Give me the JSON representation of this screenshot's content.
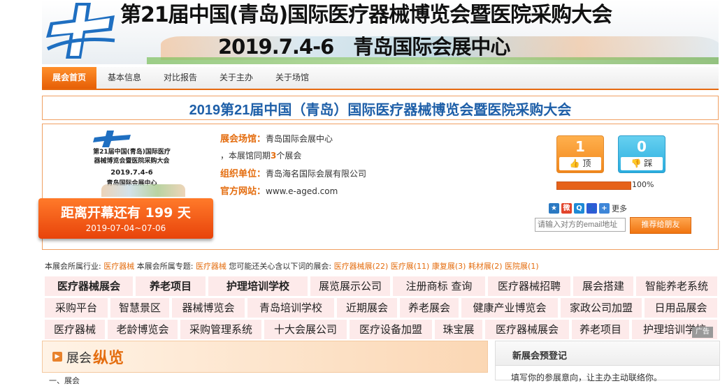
{
  "banner": {
    "title": "第21届中国(青岛)国际医疗器械博览会暨医院采购大会",
    "date": "2019.7.4-6　青岛国际会展中心"
  },
  "nav": {
    "items": [
      "展会首页",
      "基本信息",
      "对比报告",
      "关于主办",
      "关于场馆"
    ]
  },
  "page_title": "2019第21届中国（青岛）国际医疗器械博览会暨医院采购大会",
  "thumbnail": {
    "line1": "第21届中国(青岛)国际医疗",
    "line2": "器械博览会暨医院采购大会",
    "line3": "2019.7.4-6",
    "line4": "青岛国际会展中心"
  },
  "countdown": {
    "main": "距离开幕还有 199 天",
    "dates": "2019-07-04~07-06"
  },
  "info": {
    "venue_label": "展会场馆：",
    "venue": "青岛国际会展中心",
    "same_period_prefix": "，本展馆同期",
    "same_period_count": "3",
    "same_period_suffix": "个展会",
    "organizer_label": "组织单位：",
    "organizer": "青岛海名国际会展有限公司",
    "website_label": "官方网站：",
    "website": "www.e-aged.com"
  },
  "votes": {
    "up_count": "1",
    "up_label": "顶",
    "down_count": "0",
    "down_label": "踩",
    "progress_percent": 100,
    "progress_text": "100%"
  },
  "share": {
    "more_label": "更多",
    "email_placeholder": "请输入对方的email地址",
    "recommend_label": "推荐给朋友"
  },
  "colors": {
    "accent": "#e46d0f",
    "title_blue": "#1e5fa8",
    "ad_bg": "#fdeaea"
  },
  "industry": {
    "t1": "本展会所属行业:",
    "l1": "医疗器械",
    "t2": "本展会所属专题:",
    "l2": "医疗器械",
    "t3": "您可能还关心含以下词的展会:",
    "links": [
      "医疗器械展(22)",
      "医疗展(11)",
      "康复展(3)",
      "耗材展(2)",
      "医院展(1)"
    ]
  },
  "ads": {
    "row1": [
      "医疗器械展会",
      "养老项目",
      "护理培训学校",
      "展览展示公司",
      "注册商标 查询",
      "医疗器械招聘",
      "展会搭建",
      "智能养老系统"
    ],
    "row2": [
      "采购平台",
      "智慧景区",
      "器械博览会",
      "青岛培训学校",
      "近期展会",
      "养老展会",
      "健康产业博览会",
      "家政公司加盟",
      "日用品展会"
    ],
    "row3": [
      "医疗器械",
      "老龄博览会",
      "采购管理系统",
      "十大会展公司",
      "医疗设备加盟",
      "珠宝展",
      "医疗器械展会",
      "养老项目",
      "护理培训学校"
    ],
    "ad_label": "广告"
  },
  "overview": {
    "part1": "展会",
    "part2": "纵览",
    "sub": "一、展会"
  },
  "new_expo": {
    "title": "新展会预登记",
    "desc": "填写你的参展意向，让主办主动联络你。"
  }
}
